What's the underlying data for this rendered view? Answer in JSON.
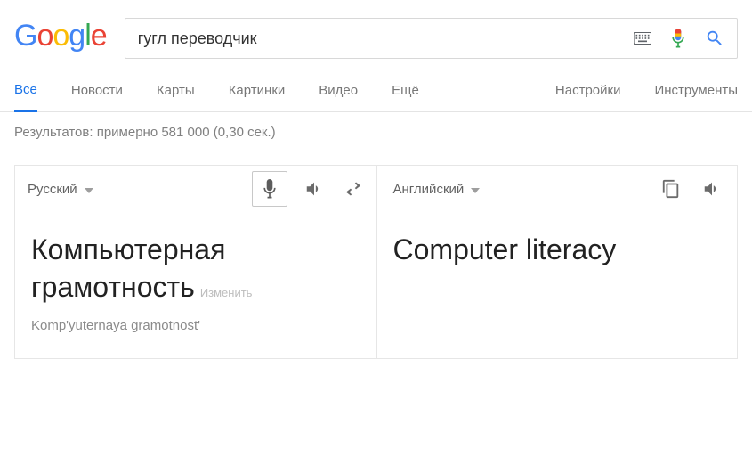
{
  "logo": {
    "g1": "G",
    "o1": "o",
    "o2": "o",
    "g2": "g",
    "l": "l",
    "e": "e"
  },
  "search": {
    "query": "гугл переводчик"
  },
  "tabs": {
    "all": "Все",
    "news": "Новости",
    "maps": "Карты",
    "images": "Картинки",
    "video": "Видео",
    "more": "Ещё",
    "settings": "Настройки",
    "tools": "Инструменты"
  },
  "stats": "Результатов: примерно 581 000 (0,30 сек.)",
  "translate": {
    "source_lang": "Русский",
    "target_lang": "Английский",
    "source_text": "Компьютерная грамотность",
    "edit_label": "Изменить",
    "transliteration": "Komp'yuternaya gramotnost'",
    "target_text": "Computer literacy"
  }
}
